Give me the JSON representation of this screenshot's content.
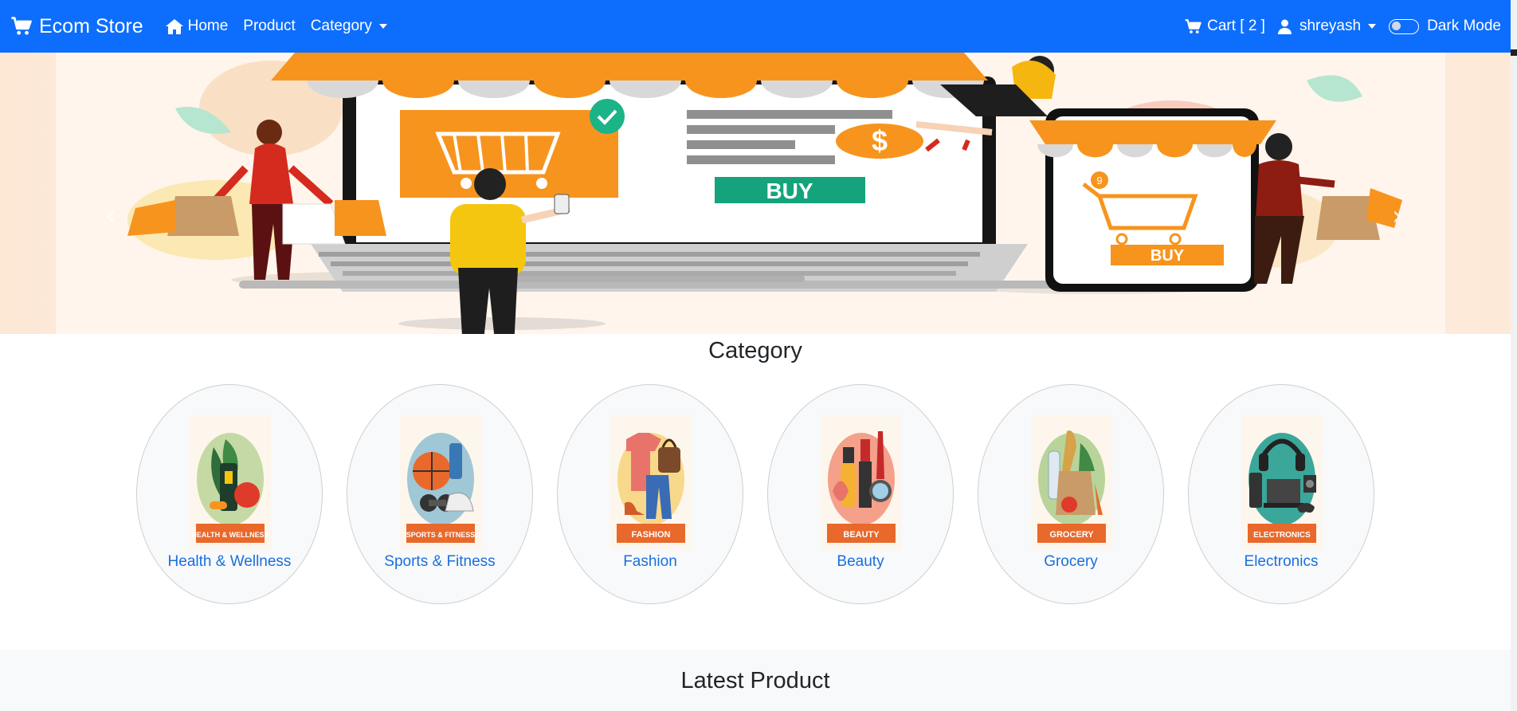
{
  "navbar": {
    "brand": "Ecom Store",
    "links": {
      "home": "Home",
      "product": "Product",
      "category": "Category"
    },
    "cart_label": "Cart [ 2 ]",
    "user": "shreyash",
    "dark_mode": "Dark Mode"
  },
  "colors": {
    "navbar": "#0d6efd",
    "link": "#1a6fdc",
    "accent": "#f7941d"
  },
  "hero": {
    "buy_label": "BUY",
    "phone_buy_label": "BUY",
    "badge_number": "9",
    "dollar": "$"
  },
  "category": {
    "title": "Category",
    "items": [
      {
        "label": "Health & Wellness",
        "badge": "HEALTH & WELLNESS",
        "icon": "health-icon"
      },
      {
        "label": "Sports & Fitness",
        "badge": "SPORTS & FITNESS",
        "icon": "sports-icon"
      },
      {
        "label": "Fashion",
        "badge": "FASHION",
        "icon": "fashion-icon"
      },
      {
        "label": "Beauty",
        "badge": "BEAUTY",
        "icon": "beauty-icon"
      },
      {
        "label": "Grocery",
        "badge": "GROCERY",
        "icon": "grocery-icon"
      },
      {
        "label": "Electronics",
        "badge": "ELECTRONICS",
        "icon": "electronics-icon"
      }
    ]
  },
  "latest": {
    "title": "Latest Product"
  }
}
